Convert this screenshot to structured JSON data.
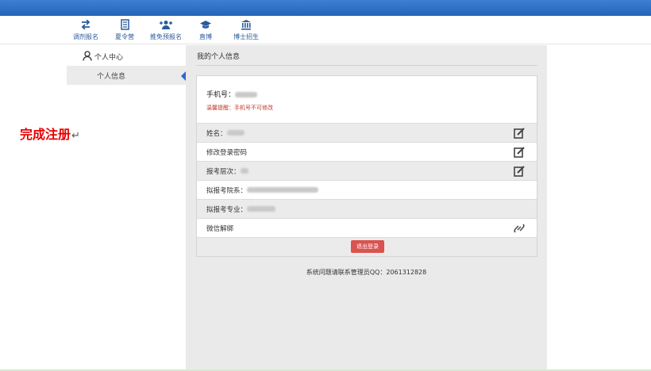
{
  "nav": {
    "items": [
      {
        "label": "调剂报名",
        "icon": "swap-icon"
      },
      {
        "label": "夏令营",
        "icon": "document-icon"
      },
      {
        "label": "推免预报名",
        "icon": "users-add-icon"
      },
      {
        "label": "直博",
        "icon": "graduation-cap-icon"
      },
      {
        "label": "博士招生",
        "icon": "institution-icon"
      }
    ]
  },
  "sidebar": {
    "title": "个人中心",
    "items": [
      {
        "label": "个人信息"
      }
    ]
  },
  "annotation": {
    "text": "完成注册",
    "return_glyph": "↵",
    "color": "#e60000"
  },
  "main": {
    "title": "我的个人信息",
    "phone_label": "手机号：",
    "phone_tip": "温馨提醒：手机号不可修改",
    "rows": [
      {
        "label": "姓名："
      },
      {
        "label": "修改登录密码"
      },
      {
        "label": "报考层次："
      },
      {
        "label": "拟报考院系："
      },
      {
        "label": "拟报考专业："
      },
      {
        "label": "微信解绑"
      }
    ],
    "logout_label": "退出登录",
    "footer": "系统问题请联系管理员QQ：2061312828"
  },
  "colors": {
    "topbar": "#2d6cc0",
    "nav_text": "#2a5a9c",
    "logout": "#d9534f",
    "tip": "#c0392b"
  }
}
